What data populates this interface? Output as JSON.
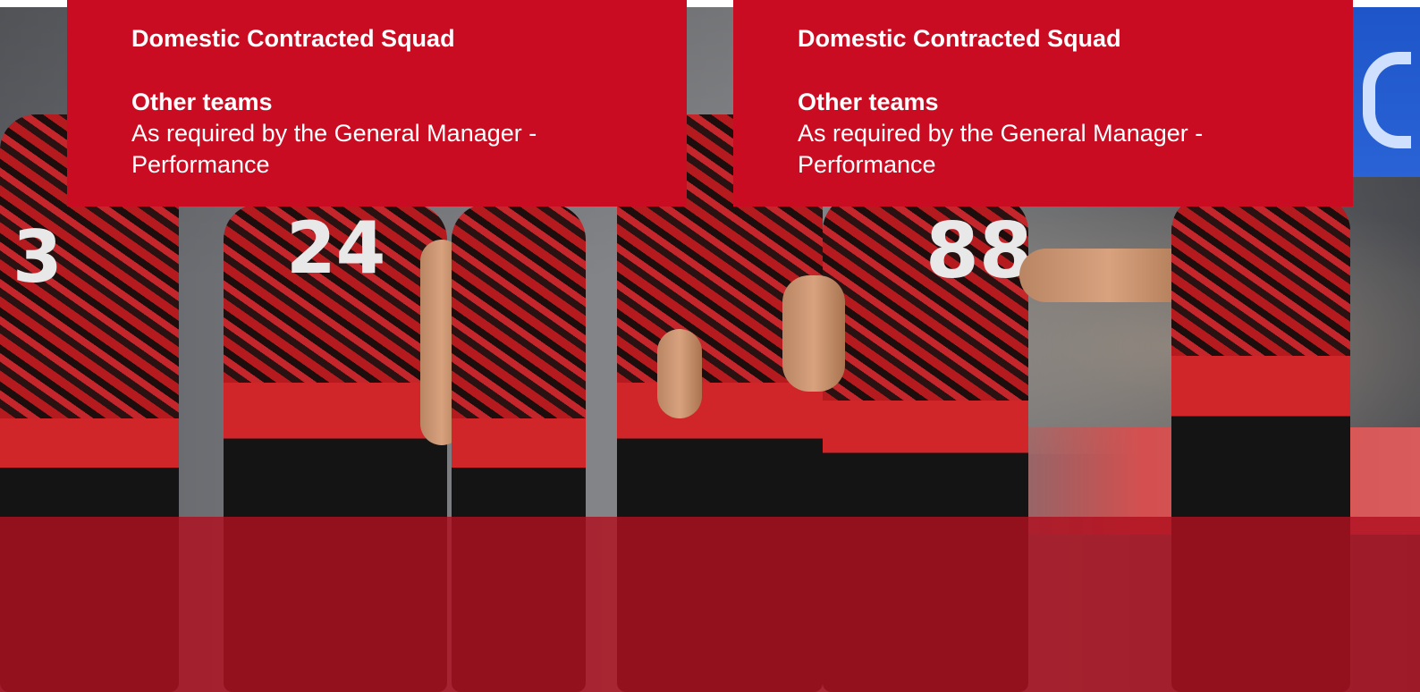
{
  "cards": [
    {
      "heading": "Domestic Contracted Squad",
      "subheading": "Other teams",
      "text": "As required by the General Manager - Performance"
    },
    {
      "heading": "Domestic Contracted Squad",
      "subheading": "Other teams",
      "text": "As required by the General Manager - Performance"
    }
  ],
  "photo": {
    "jersey_numbers": [
      "3",
      "24",
      "88"
    ],
    "colors": {
      "card_red": "#c90c22",
      "overlay_red": "#b01020",
      "jersey_red": "#c4262b",
      "jersey_black": "#141414"
    }
  }
}
